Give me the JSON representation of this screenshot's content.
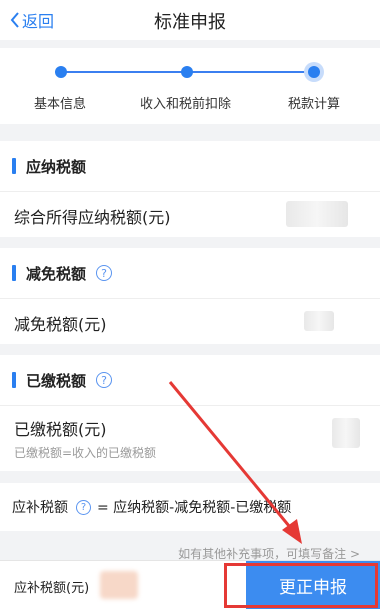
{
  "nav": {
    "back_label": "返回",
    "title": "标准申报"
  },
  "steps": [
    "基本信息",
    "收入和税前扣除",
    "税款计算"
  ],
  "sections": {
    "payable": {
      "title": "应纳税额",
      "row_label": "综合所得应纳税额(元)"
    },
    "reduction": {
      "title": "减免税额",
      "help": "?",
      "row_label": "减免税额(元)"
    },
    "paid": {
      "title": "已缴税额",
      "help": "?",
      "row_label": "已缴税额(元)",
      "row_sub": "已缴税额=收入的已缴税额"
    }
  },
  "formula": {
    "label": "应补税额",
    "help": "?",
    "text": "= 应纳税额-减免税额-已缴税额"
  },
  "note": "如有其他补充事项，可填写备注 >",
  "bottom": {
    "amount_label": "应补税额(元)",
    "submit_label": "更正申报"
  },
  "colors": {
    "accent": "#2a7ff0",
    "submit": "#3c8cf0",
    "annotation": "#e53935"
  }
}
